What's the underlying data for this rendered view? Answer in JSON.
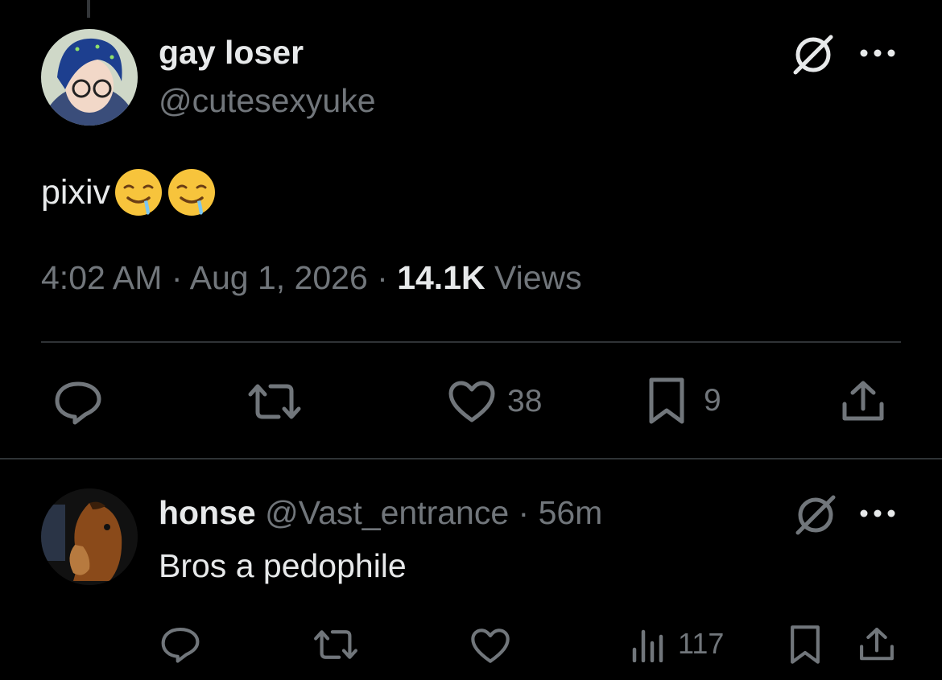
{
  "main_tweet": {
    "display_name": "gay loser",
    "handle": "@cutesexyuke",
    "text": "pixiv",
    "emojis": [
      "drooling-face-emoji",
      "drooling-face-emoji"
    ],
    "time": "4:02 AM",
    "separator": " · ",
    "date": "Aug 1, 2026",
    "views_count": "14.1K",
    "views_label": " Views",
    "actions": {
      "reply_icon": "reply-icon",
      "retweet_icon": "retweet-icon",
      "like_icon": "heart-icon",
      "like_count": "38",
      "bookmark_icon": "bookmark-icon",
      "bookmark_count": "9",
      "share_icon": "share-icon"
    }
  },
  "reply_tweet": {
    "display_name": "honse",
    "handle": "@Vast_entrance",
    "separator": " · ",
    "time_ago": "56m",
    "text": "Bros a pedophile",
    "actions": {
      "views_icon": "analytics-icon",
      "views_count": "117"
    }
  },
  "colors": {
    "background": "#000000",
    "primary_text": "#e7e9ea",
    "secondary_text": "#71767b",
    "divider": "#2f3336"
  }
}
